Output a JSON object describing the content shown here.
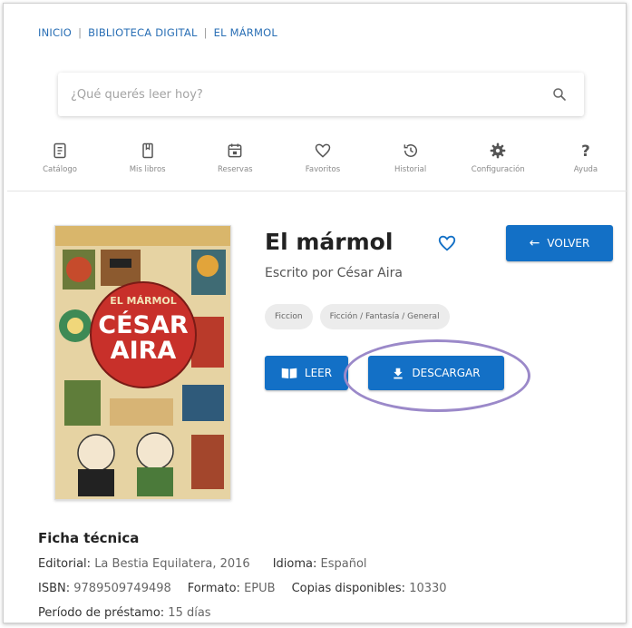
{
  "breadcrumb": [
    {
      "label": "INICIO"
    },
    {
      "label": "BIBLIOTECA DIGITAL"
    },
    {
      "label": "EL MÁRMOL"
    }
  ],
  "search": {
    "placeholder": "¿Qué querés leer hoy?",
    "icon": "search-icon"
  },
  "nav": [
    {
      "label": "Catálogo",
      "icon": "catalog-icon"
    },
    {
      "label": "Mis libros",
      "icon": "book-icon"
    },
    {
      "label": "Reservas",
      "icon": "calendar-icon"
    },
    {
      "label": "Favoritos",
      "icon": "heart-icon"
    },
    {
      "label": "Historial",
      "icon": "history-icon"
    },
    {
      "label": "Configuración",
      "icon": "gear-icon"
    },
    {
      "label": "Ayuda",
      "icon": "help-icon"
    }
  ],
  "book": {
    "title": "El mármol",
    "author_line": "Escrito por César Aira",
    "cover_author_top": "EL MÁRMOL",
    "cover_author_name_1": "CÉSAR",
    "cover_author_name_2": "AIRA",
    "tags": [
      "Ficcion",
      "Ficción / Fantasía / General"
    ]
  },
  "actions": {
    "back_label": "VOLVER",
    "read_label": "LEER",
    "download_label": "DESCARGAR"
  },
  "ficha": {
    "title": "Ficha técnica",
    "editorial_label": "Editorial:",
    "editorial_value": "La Bestia Equilatera, 2016",
    "idioma_label": "Idioma:",
    "idioma_value": "Español",
    "isbn_label": "ISBN:",
    "isbn_value": "9789509749498",
    "formato_label": "Formato:",
    "formato_value": "EPUB",
    "copias_label": "Copias disponibles:",
    "copias_value": "10330",
    "periodo_label": "Período de préstamo:",
    "periodo_value": "15 días"
  },
  "colors": {
    "primary": "#1370c6",
    "link": "#2a6fb5",
    "highlight": "#9b89c9"
  }
}
